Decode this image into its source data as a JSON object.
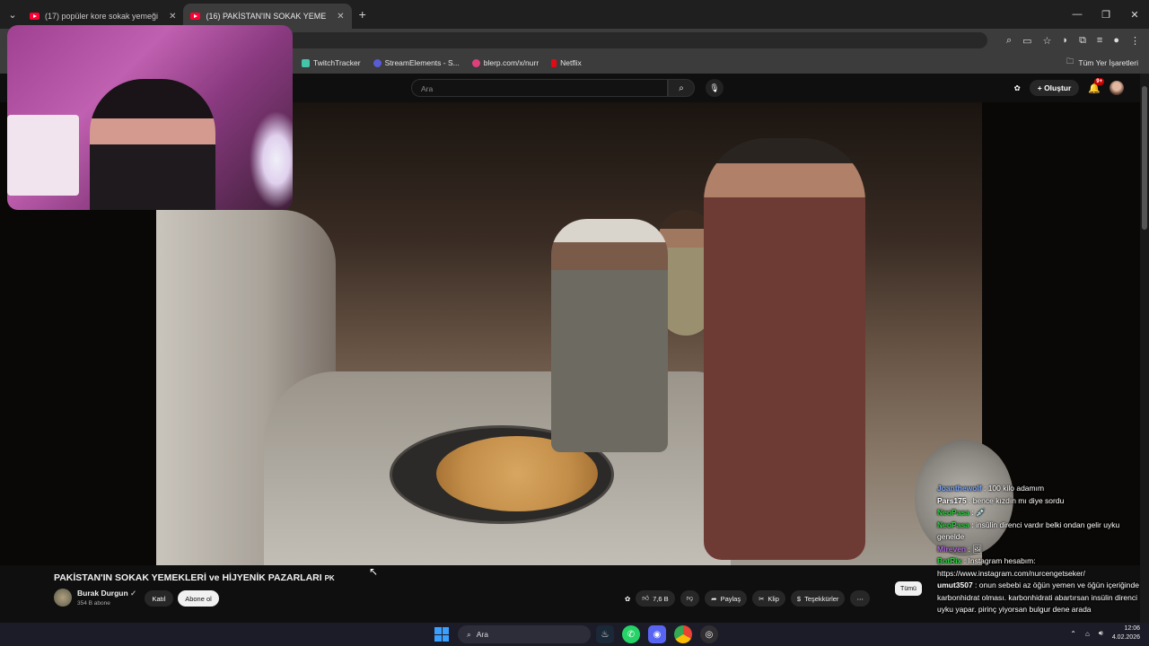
{
  "browser": {
    "tabs": [
      {
        "label": "(17) popüler kore sokak yemeği",
        "active": false
      },
      {
        "label": "(16) PAKİSTAN'IN SOKAK YEME",
        "active": true
      }
    ],
    "bookmarks": [
      {
        "label": "TwitchTracker",
        "icon_color": "#44c4a8"
      },
      {
        "label": "StreamElements - S...",
        "icon_color": "#5b5bd6"
      },
      {
        "label": "blerp.com/x/nurr",
        "icon_color": "#e0407a"
      },
      {
        "label": "Netflix",
        "icon_color": "#e50914"
      }
    ],
    "bookmarks_folder": "Tüm Yer İşaretleri"
  },
  "youtube": {
    "search_placeholder": "Ara",
    "create_label": "Oluştur",
    "notif_count": "9+",
    "video_title": "PAKİSTAN'IN SOKAK YEMEKLERİ ve HİJYENİK PAZARLARI",
    "title_suffix": "PK",
    "channel_name": "Burak Durgun",
    "channel_subs": "354 B abone",
    "join_label": "Katıl",
    "subscribe_label": "Abone ol",
    "likes": "7,6 B",
    "share_label": "Paylaş",
    "clip_label": "Klip",
    "thanks_label": "Teşekkürler",
    "chip_all": "Tümü"
  },
  "chat": [
    {
      "name": "Joanthewolf",
      "text": "100 kilo adamım",
      "color": "#7aa8ff"
    },
    {
      "name": "Pars175",
      "text": "bence kızdın mı diye sordu",
      "color": "#ffffff"
    },
    {
      "name": "NeoPasa",
      "text": "💉",
      "color": "#2ecc40"
    },
    {
      "name": "NeoPasa",
      "text": "insülin direnci vardır belki ondan gelir uyku genelde",
      "color": "#2ecc40"
    },
    {
      "name": "Mireven",
      "text": "🖼",
      "color": "#b06ad8"
    },
    {
      "name": "BotRix",
      "text": "Instagram hesabım: https://www.instagram.com/nurcengetseker/",
      "color": "#2ecc40"
    },
    {
      "name": "umut3507",
      "text": "onun sebebi az öğün yemen ve öğün içeriğinde karbonhidrat olması. karbonhidrati abartırsan insülin direnci uyku yapar. pirinç yiyorsan bulgur dene arada",
      "color": "#ffffff"
    }
  ],
  "taskbar": {
    "search_label": "Ara",
    "time": "12:06",
    "date": "4.02.2026"
  }
}
